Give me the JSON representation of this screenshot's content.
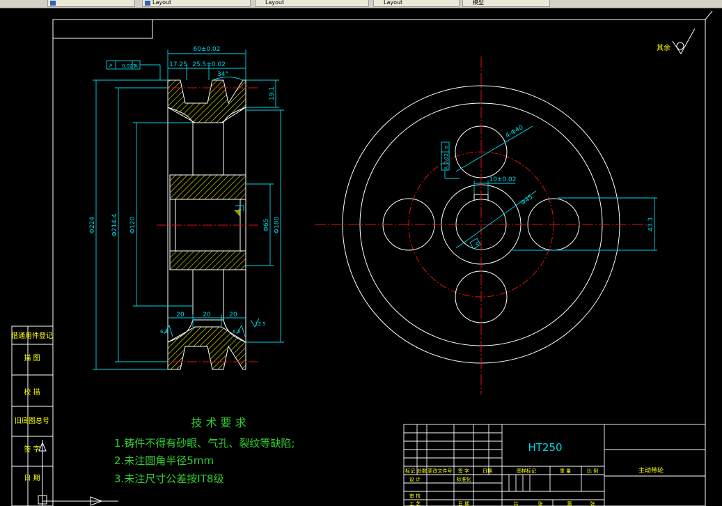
{
  "tabs": [
    {
      "label": ""
    },
    {
      "label": "Layout"
    },
    {
      "label": "Layout"
    },
    {
      "label": "Layout"
    },
    {
      "label": "模型"
    }
  ],
  "roughness": {
    "label": "其余"
  },
  "dims": {
    "overall_width": "60±0.02",
    "d1": "17.25",
    "d2": "25.5±0.02",
    "angle": "34°",
    "groove_depth": "19.1",
    "runout": "0.027",
    "runout_ref": "A",
    "dia_224": "Φ224",
    "dia_214": "Φ214.4",
    "dia_120": "Φ120",
    "dia_65": "Φ65",
    "dia_180": "Φ180",
    "w20a": "20",
    "w20b": "20",
    "w20c": "20",
    "hole_spec": "4-Φ40",
    "keyway": "10±0.02",
    "bore_dia": "Φ45",
    "key_depth": "43.3",
    "sym_tol": "0.02",
    "sym_ref": "A",
    "datum_a": "A",
    "r12": "6.3",
    "r12b": "6.3",
    "r12c": "12.5"
  },
  "notes": {
    "title": "技 术 要 求",
    "items": [
      "1.铸件不得有砂眼、气孔、裂纹等缺陷;",
      "2.未注圆角半径5mm",
      "3.未注尺寸公差按IT8级"
    ]
  },
  "left_column": {
    "cells": [
      "借通用件登记",
      "描 图",
      "校 描",
      "旧底图总号",
      "签 字",
      "日 期"
    ]
  },
  "title_block": {
    "material": "HT250",
    "part_name": "主动带轮",
    "headers": [
      "标记",
      "处数",
      "更改文件号",
      "签 字",
      "日期"
    ],
    "design": "设 计",
    "standardize": "标准化",
    "review": "审 核",
    "process": "工 艺",
    "date": "日 期",
    "stage_mark": "图样标记",
    "weight": "重 量",
    "scale": "比 例",
    "sheets": "共",
    "sheet_of": "张",
    "sheet_no": "第",
    "sheet_suffix": "张"
  },
  "colors": {
    "outline": "#ffffff",
    "dimension": "#00d8e8",
    "centerline": "#e01010",
    "hatch": "#ffff00",
    "text_green": "#30d030",
    "frame": "#ffffff"
  }
}
